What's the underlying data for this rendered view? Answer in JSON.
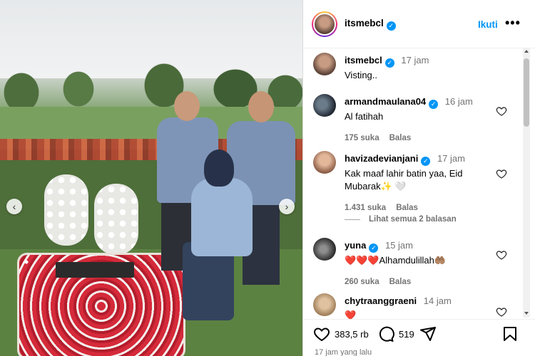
{
  "post": {
    "author": "itsmebcl",
    "follow_label": "Ikuti",
    "more_label": "•••",
    "caption": {
      "username": "itsmebcl",
      "time": "17 jam",
      "text": "Visting.."
    }
  },
  "comments": [
    {
      "username": "armandmaulana04",
      "verified": true,
      "time": "16 jam",
      "text": "Al fatihah",
      "likes": "175 suka",
      "reply_label": "Balas"
    },
    {
      "username": "havizadevianjani",
      "verified": true,
      "time": "17 jam",
      "text": "Kak maaf lahir batin yaa, Eid Mubarak✨ 🤍",
      "likes": "1.431 suka",
      "reply_label": "Balas",
      "view_replies": "Lihat semua 2 balasan"
    },
    {
      "username": "yuna",
      "verified": true,
      "time": "15 jam",
      "text": "❤️❤️❤️Alhamdulillah🤲🏽",
      "likes": "260 suka",
      "reply_label": "Balas"
    },
    {
      "username": "chytraanggraeni",
      "verified": false,
      "time": "14 jam",
      "text": "❤️"
    }
  ],
  "actions": {
    "like_count": "383,5 rb",
    "comment_count": "519",
    "post_date": "17 jam yang lalu"
  },
  "carousel": {
    "prev": "‹",
    "next": "›"
  },
  "colors": {
    "accent": "#0095f6",
    "secondary_text": "#737373",
    "verified": "#0095f6"
  }
}
